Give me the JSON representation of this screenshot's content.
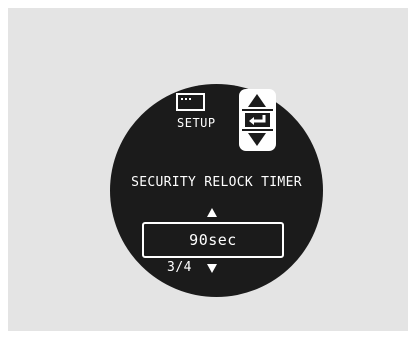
{
  "screen": {
    "setup_label": "SETUP",
    "setting_title": "SECURITY RELOCK TIMER",
    "value": "90sec",
    "page_indicator": "3/4"
  },
  "icons": {
    "setup": "setup-screen-icon",
    "up": "triangle-up-icon",
    "enter": "enter-return-icon",
    "down": "triangle-down-icon"
  },
  "colors": {
    "background": "#e4e4e4",
    "display": "#1b1b1b",
    "foreground": "#ffffff"
  }
}
